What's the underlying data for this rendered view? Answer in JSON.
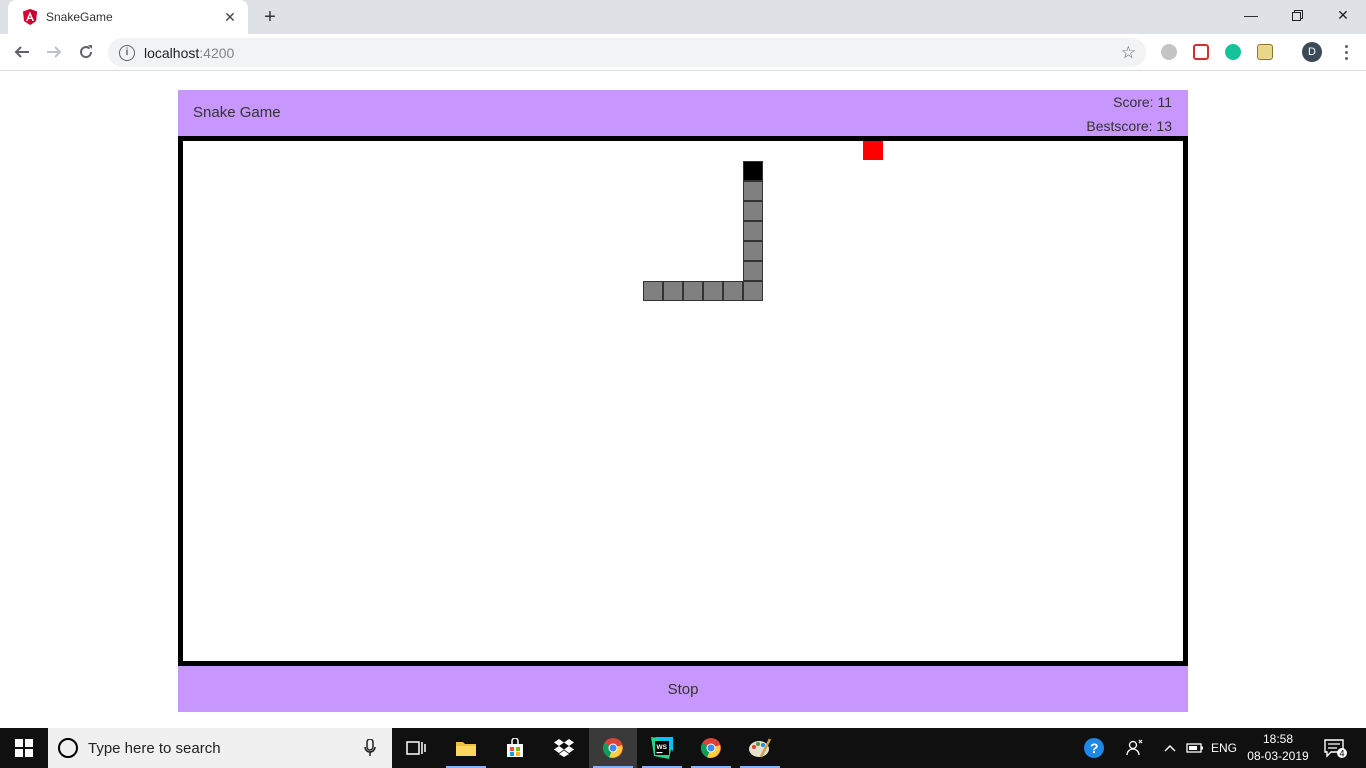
{
  "browser": {
    "tab_title": "SnakeGame",
    "url_host": "localhost",
    "url_port": ":4200",
    "profile_initial": "D"
  },
  "game": {
    "title": "Snake Game",
    "score_label": "Score: 11",
    "bestscore_label": "Bestscore: 13",
    "stop_label": "Stop",
    "colors": {
      "header_bg": "#c797fd",
      "snake_head": "#000000",
      "snake_body": "#808080",
      "food": "#ff0000"
    },
    "grid": {
      "cell": 20,
      "cols": 50,
      "rows": 26
    },
    "snake": [
      {
        "col": 28,
        "row": 1
      },
      {
        "col": 28,
        "row": 2
      },
      {
        "col": 28,
        "row": 3
      },
      {
        "col": 28,
        "row": 4
      },
      {
        "col": 28,
        "row": 5
      },
      {
        "col": 28,
        "row": 6
      },
      {
        "col": 28,
        "row": 7
      },
      {
        "col": 27,
        "row": 7
      },
      {
        "col": 26,
        "row": 7
      },
      {
        "col": 25,
        "row": 7
      },
      {
        "col": 24,
        "row": 7
      },
      {
        "col": 23,
        "row": 7
      }
    ],
    "food": {
      "col": 34,
      "row": 0
    }
  },
  "taskbar": {
    "search_placeholder": "Type here to search",
    "language": "ENG",
    "time": "18:58",
    "date": "08-03-2019",
    "notifications": "4"
  }
}
